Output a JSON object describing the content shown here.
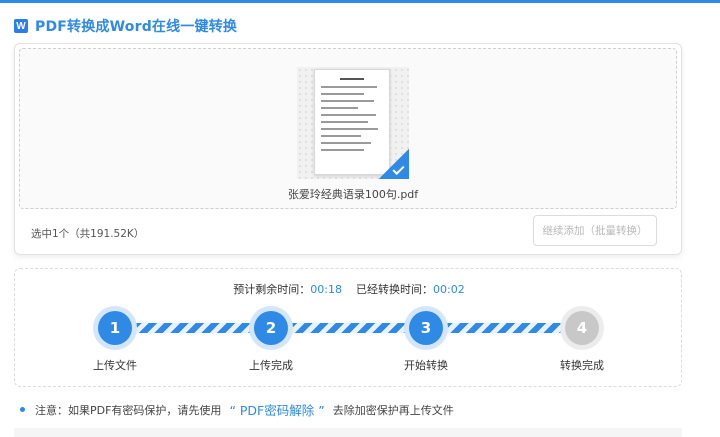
{
  "header": {
    "icon_glyph": "W",
    "title": "PDF转换成Word在线一键转换"
  },
  "upload": {
    "file_name": "张爱玲经典语录100句.pdf",
    "selected_info": "选中1个（共191.52K）",
    "add_more_label": "继续添加（批量转换）"
  },
  "progress": {
    "remaining_label": "预计剩余时间：",
    "remaining_value": "00:18",
    "elapsed_label": "已经转换时间：",
    "elapsed_value": "00:02",
    "steps": [
      {
        "number": "1",
        "label": "上传文件",
        "status": "done"
      },
      {
        "number": "2",
        "label": "上传完成",
        "status": "done"
      },
      {
        "number": "3",
        "label": "开始转换",
        "status": "active"
      },
      {
        "number": "4",
        "label": "转换完成",
        "status": "pending"
      }
    ]
  },
  "notice": {
    "prefix": "注意：如果PDF有密码保护，请先使用",
    "link": "“ PDF密码解除 ”",
    "suffix": "去除加密保护再上传文件"
  },
  "colors": {
    "accent": "#2f8ae5",
    "pending": "#c8c8c8"
  }
}
